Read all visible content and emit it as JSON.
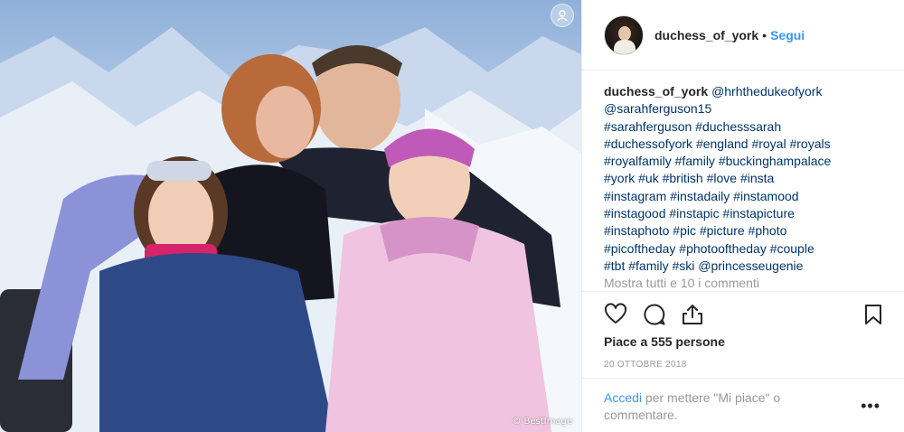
{
  "post": {
    "username": "duchess_of_york",
    "dot": "•",
    "follow_label": "Segui",
    "caption": {
      "username": "duchess_of_york",
      "text": [
        "@hrhthedukeofyork",
        "@sarahferguson15",
        "#sarahferguson #duchesssarah",
        "#duchessofyork #england #royal #royals",
        "#royalfamily #family #buckinghampalace",
        "#york #uk #british #love #insta",
        "#instagram #instadaily #instamood",
        "#instagood #instapic #instapicture",
        "#instaphoto #pic #picture #photo",
        "#picoftheday #photooftheday #couple",
        "#tbt #family #ski @princesseugenie"
      ],
      "more_comments": "Mostra tutti e 10 i commenti"
    },
    "likes": "Piace a 555 persone",
    "date": "20 OTTOBRE 2018",
    "comment_prompt": {
      "login": "Accedi",
      "rest": " per mettere \"Mi piace\" o commentare."
    },
    "more_options": "•••",
    "photo_credit": "© BestImage"
  },
  "icons": {
    "like": "heart-icon",
    "comment": "comment-bubble-icon",
    "share": "share-icon",
    "save": "bookmark-icon",
    "tag": "user-tag-icon"
  },
  "colors": {
    "link_blue": "#3897f0",
    "hashtag_blue": "#003569",
    "muted_gray": "#999999",
    "text": "#262626"
  }
}
